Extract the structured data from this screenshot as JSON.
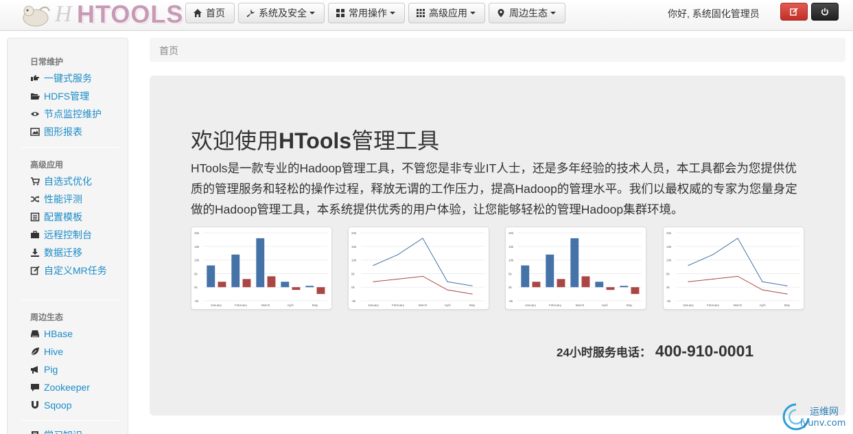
{
  "brand": {
    "logo_text": "HTOOLS"
  },
  "nav": {
    "items": [
      {
        "label": "首页",
        "icon": "home-icon",
        "dropdown": false
      },
      {
        "label": "系统及安全",
        "icon": "wrench-icon",
        "dropdown": true
      },
      {
        "label": "常用操作",
        "icon": "grid-icon",
        "dropdown": true
      },
      {
        "label": "高级应用",
        "icon": "grid-small-icon",
        "dropdown": true
      },
      {
        "label": "周边生态",
        "icon": "map-marker-icon",
        "dropdown": true
      }
    ],
    "greeting": "你好, 系统固化管理员",
    "edit_button_icon": "edit-icon",
    "power_button_icon": "power-icon"
  },
  "sidebar": {
    "sections": [
      {
        "title": "日常维护",
        "items": [
          {
            "label": "一键式服务",
            "icon": "hand-right-icon"
          },
          {
            "label": "HDFS管理",
            "icon": "folder-open-icon"
          },
          {
            "label": "节点监控维护",
            "icon": "eye-icon"
          },
          {
            "label": "图形报表",
            "icon": "picture-icon"
          }
        ]
      },
      {
        "title": "高级应用",
        "items": [
          {
            "label": "自选式优化",
            "icon": "shopping-cart-icon"
          },
          {
            "label": "性能评测",
            "icon": "random-icon"
          },
          {
            "label": "配置模板",
            "icon": "list-alt-icon"
          },
          {
            "label": "远程控制台",
            "icon": "briefcase-icon"
          },
          {
            "label": "数据迁移",
            "icon": "download-icon"
          },
          {
            "label": "自定义MR任务",
            "icon": "edit-icon"
          }
        ]
      },
      {
        "title": "周边生态",
        "items": [
          {
            "label": "HBase",
            "icon": "hdd-icon"
          },
          {
            "label": "Hive",
            "icon": "leaf-icon"
          },
          {
            "label": "Pig",
            "icon": "bullhorn-icon"
          },
          {
            "label": "Zookeeper",
            "icon": "comment-icon"
          },
          {
            "label": "Sqoop",
            "icon": "magnet-icon"
          }
        ]
      },
      {
        "title": "",
        "items": [
          {
            "label": "学习知识",
            "icon": "book-icon"
          }
        ]
      }
    ]
  },
  "breadcrumb": {
    "current": "首页"
  },
  "hero": {
    "title_prefix": "欢迎使用",
    "title_bold": "HTools",
    "title_suffix": "管理工具",
    "description": "HTools是一款专业的Hadoop管理工具，不管您是非专业IT人士，还是多年经验的技术人员，本工具都会为您提供优质的管理服务和轻松的操作过程，释放无谓的工作压力，提高Hadoop的管理水平。我们以最权威的专家为您量身定做的Hadoop管理工具，本系统提供优秀的用户体验，让您能够轻松的管理Hadoop集群环境。",
    "phone_label": "24小时服务电话：",
    "phone_number": "400-910-0001"
  },
  "chart_data": [
    {
      "type": "bar",
      "categories": [
        "January",
        "February",
        "March",
        "April",
        "May"
      ],
      "y_ticks": [
        "20k",
        "15k",
        "10k",
        "5k",
        "0k",
        "-5k"
      ],
      "ylim": [
        -5000,
        20000
      ],
      "series": [
        {
          "values": [
            8000,
            12000,
            18000,
            2000,
            500
          ],
          "color": "#4572a7"
        },
        {
          "values": [
            2000,
            3000,
            4000,
            -1000,
            -2500
          ],
          "color": "#aa4643"
        }
      ]
    },
    {
      "type": "line",
      "categories": [
        "January",
        "February",
        "March",
        "April",
        "May"
      ],
      "y_ticks": [
        "20k",
        "15k",
        "10k",
        "5k",
        "0k",
        "-5k"
      ],
      "ylim": [
        -5000,
        20000
      ],
      "series": [
        {
          "values": [
            8000,
            12000,
            18000,
            2000,
            500
          ],
          "color": "#4572a7"
        },
        {
          "values": [
            2000,
            3000,
            4000,
            -1000,
            -2500
          ],
          "color": "#aa4643"
        }
      ]
    },
    {
      "type": "bar",
      "categories": [
        "January",
        "February",
        "March",
        "April",
        "May"
      ],
      "y_ticks": [
        "20k",
        "15k",
        "10k",
        "5k",
        "0k",
        "-5k"
      ],
      "ylim": [
        -5000,
        20000
      ],
      "series": [
        {
          "values": [
            8000,
            12000,
            18000,
            2000,
            500
          ],
          "color": "#4572a7"
        },
        {
          "values": [
            2000,
            3000,
            4000,
            -1000,
            -2500
          ],
          "color": "#aa4643"
        }
      ]
    },
    {
      "type": "line",
      "categories": [
        "January",
        "February",
        "March",
        "April",
        "May"
      ],
      "y_ticks": [
        "20k",
        "15k",
        "10k",
        "5k",
        "0k",
        "-5k"
      ],
      "ylim": [
        -5000,
        20000
      ],
      "series": [
        {
          "values": [
            8000,
            12000,
            18000,
            2000,
            500
          ],
          "color": "#4572a7"
        },
        {
          "values": [
            2000,
            3000,
            4000,
            -1000,
            -2500
          ],
          "color": "#aa4643"
        }
      ]
    }
  ],
  "watermark": {
    "line1": "运维网",
    "line2": "iyunv.com"
  }
}
